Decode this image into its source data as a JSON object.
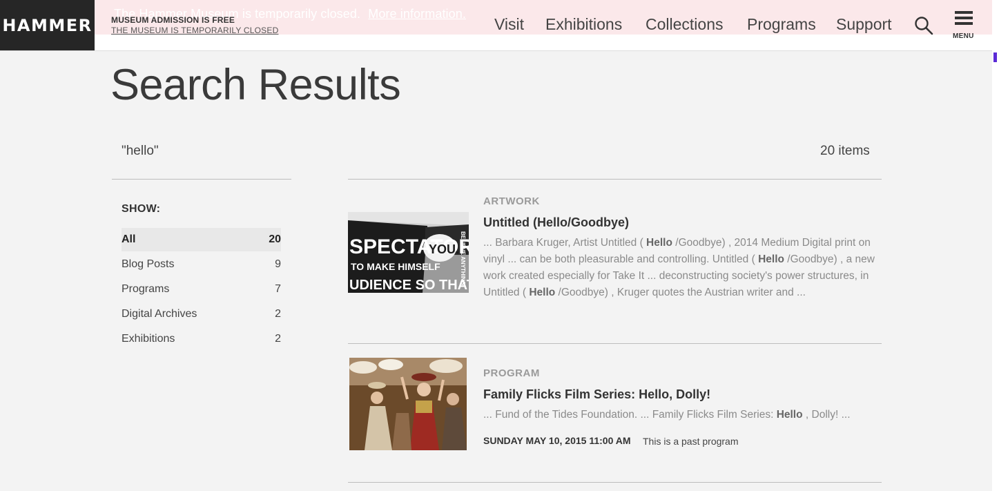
{
  "header": {
    "logo": "HAMMER",
    "alert_text": "The Hammer Museum is temporarily closed.",
    "alert_link": "More information.",
    "admission": "MUSEUM ADMISSION IS FREE",
    "closed_link": "THE MUSEUM IS TEMPORARILY CLOSED",
    "nav": [
      "Visit",
      "Exhibitions",
      "Collections",
      "Programs",
      "Support"
    ],
    "menu_label": "MENU"
  },
  "page": {
    "title": "Search Results",
    "query": "\"hello\"",
    "items_count": "20 items"
  },
  "sidebar": {
    "show_label": "SHOW:",
    "filters": [
      {
        "label": "All",
        "count": "20"
      },
      {
        "label": "Blog Posts",
        "count": "9"
      },
      {
        "label": "Programs",
        "count": "7"
      },
      {
        "label": "Digital Archives",
        "count": "2"
      },
      {
        "label": "Exhibitions",
        "count": "2"
      }
    ]
  },
  "results": [
    {
      "type": "ARTWORK",
      "title": "Untitled (Hello/Goodbye)",
      "excerpt_parts": [
        "... Barbara Kruger, Artist Untitled ( ",
        "Hello",
        " /Goodbye) , 2014 Medium Digital print on vinyl ... can be both pleasurable and controlling. Untitled ( ",
        "Hello",
        " /Goodbye) , a new work created especially for Take It ... deconstructing society's power structures, in Untitled ( ",
        "Hello",
        " /Goodbye) , Kruger quotes the Austrian writer and ..."
      ],
      "image_text": [
        "SPECTATOR",
        "YOU.",
        "TO MAKE HIMSELF",
        "UDIENCE SO THAT THEY",
        "BELIEVE ANYTHING"
      ]
    },
    {
      "type": "PROGRAM",
      "title": "Family Flicks Film Series: Hello, Dolly!",
      "excerpt_parts": [
        "... Fund of the Tides Foundation. ... Family Flicks Film Series: ",
        "Hello",
        " , Dolly! ..."
      ],
      "date": "SUNDAY MAY 10, 2015 11:00 AM",
      "status": "This is a past program"
    }
  ],
  "colors": {
    "background": "#f3f3f3",
    "logo_bg": "#262626",
    "alert_band": "#fbe8ea",
    "type_label": "#9a9a9a"
  },
  "icons": [
    "search-icon",
    "hamburger-menu-icon"
  ]
}
